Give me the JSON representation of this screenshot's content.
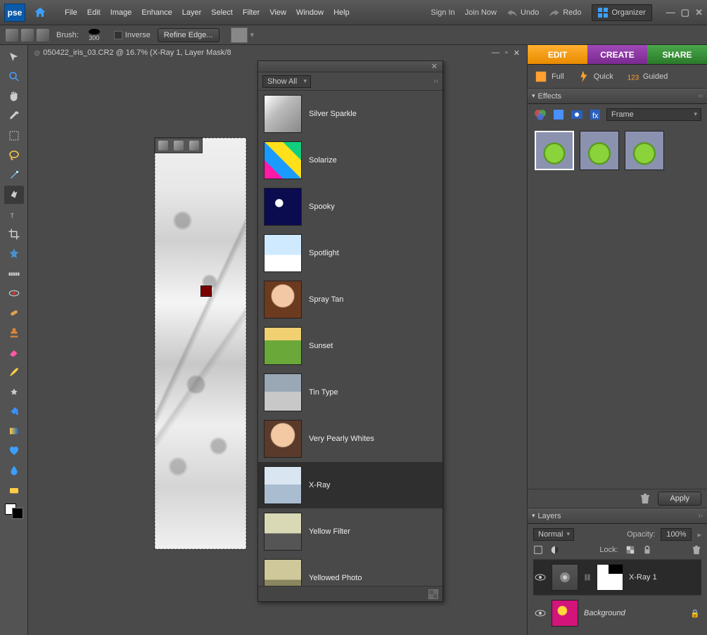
{
  "app": {
    "logo": "pse"
  },
  "menus": [
    "File",
    "Edit",
    "Image",
    "Enhance",
    "Layer",
    "Select",
    "Filter",
    "View",
    "Window",
    "Help"
  ],
  "auth": {
    "signin": "Sign In",
    "join": "Join Now"
  },
  "history": {
    "undo": "Undo",
    "redo": "Redo"
  },
  "organizer": "Organizer",
  "options": {
    "brush_label": "Brush:",
    "brush_size": "300",
    "inverse": "Inverse",
    "refine": "Refine Edge..."
  },
  "document": {
    "title": "050422_iris_03.CR2 @ 16.7% (X-Ray 1, Layer Mask/8"
  },
  "smart": {
    "filter": "Show All",
    "items": [
      {
        "label": "Silver Sparkle",
        "cls": "t-silver"
      },
      {
        "label": "Solarize",
        "cls": "t-solar"
      },
      {
        "label": "Spooky",
        "cls": "t-spooky"
      },
      {
        "label": "Spotlight",
        "cls": "t-spot"
      },
      {
        "label": "Spray Tan",
        "cls": "t-spray"
      },
      {
        "label": "Sunset",
        "cls": "t-sunset"
      },
      {
        "label": "Tin Type",
        "cls": "t-tin"
      },
      {
        "label": "Very Pearly Whites",
        "cls": "t-pearl"
      },
      {
        "label": "X-Ray",
        "cls": "t-xray",
        "selected": true
      },
      {
        "label": "Yellow Filter",
        "cls": "t-yellow"
      },
      {
        "label": "Yellowed Photo",
        "cls": "t-yphoto"
      }
    ]
  },
  "tabs": {
    "edit": "EDIT",
    "create": "CREATE",
    "share": "SHARE"
  },
  "modes": {
    "full": "Full",
    "quick": "Quick",
    "guided": "Guided"
  },
  "effects": {
    "title": "Effects",
    "select": "Frame",
    "apply": "Apply"
  },
  "layers": {
    "title": "Layers",
    "blend": "Normal",
    "opacity_label": "Opacity:",
    "opacity": "100%",
    "lock_label": "Lock:",
    "rows": [
      {
        "name": "X-Ray 1",
        "selected": true,
        "mask": true
      },
      {
        "name": "Background",
        "locked": true,
        "italic": true
      }
    ]
  }
}
